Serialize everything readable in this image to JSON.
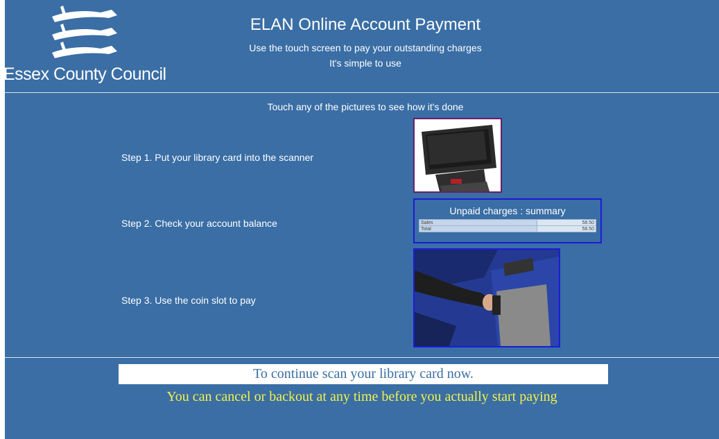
{
  "logo": {
    "text": "Essex County Council",
    "icon": "three-seaxes-icon"
  },
  "header": {
    "title": "ELAN Online Account Payment",
    "subtitle1": "Use the touch screen to pay your outstanding charges",
    "subtitle2": "It's simple to use"
  },
  "instruction": "Touch any of the pictures to see how it's done",
  "steps": [
    {
      "label": "Step 1. Put your library card into the scanner",
      "picture": "card-scanner-terminal-image"
    },
    {
      "label": "Step 2. Check your account balance",
      "picture": "unpaid-charges-summary-image"
    },
    {
      "label": "Step 3. Use the coin slot to pay",
      "picture": "coin-slot-image"
    }
  ],
  "summary": {
    "title": "Unpaid charges : summary",
    "rows": [
      {
        "label": "Sales",
        "value": "58.50"
      },
      {
        "label": "Total",
        "value": "58.50"
      }
    ]
  },
  "footer": {
    "scan_prompt": "To continue scan your library card now.",
    "cancel_note": "You can cancel or backout at any time before you actually start paying"
  },
  "colors": {
    "background": "#3a6ea5",
    "prompt_text": "#3a6ea5",
    "cancel_text": "#f2f24a",
    "pic1_border": "#6b1f66",
    "pic_border": "#1b1bd8"
  }
}
